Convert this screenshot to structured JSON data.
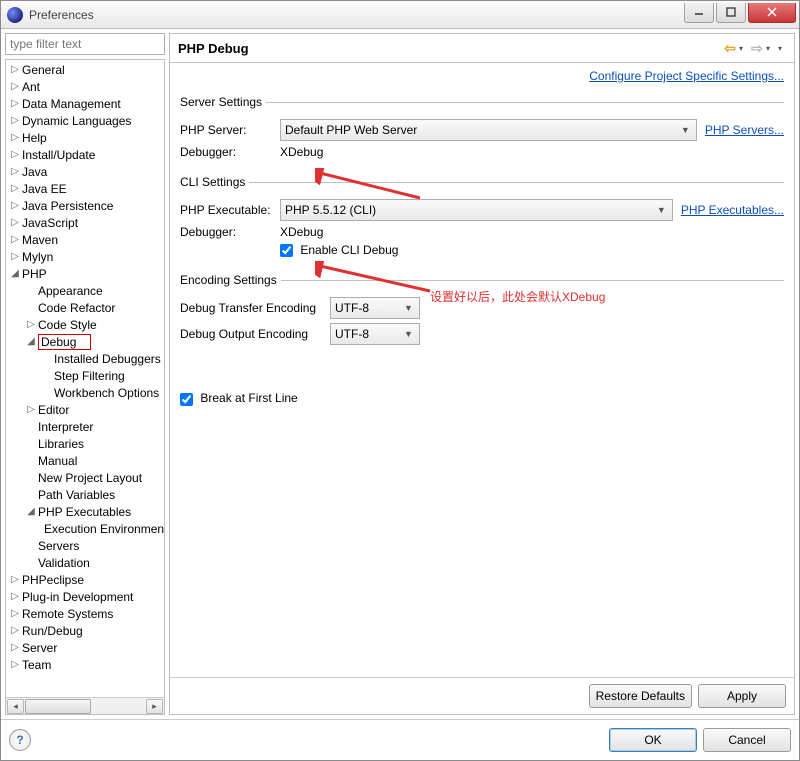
{
  "window": {
    "title": "Preferences"
  },
  "sidebar": {
    "filter_placeholder": "type filter text",
    "items": [
      {
        "label": "General",
        "depth": 0,
        "twisty": "▷"
      },
      {
        "label": "Ant",
        "depth": 0,
        "twisty": "▷"
      },
      {
        "label": "Data Management",
        "depth": 0,
        "twisty": "▷"
      },
      {
        "label": "Dynamic Languages",
        "depth": 0,
        "twisty": "▷"
      },
      {
        "label": "Help",
        "depth": 0,
        "twisty": "▷"
      },
      {
        "label": "Install/Update",
        "depth": 0,
        "twisty": "▷"
      },
      {
        "label": "Java",
        "depth": 0,
        "twisty": "▷"
      },
      {
        "label": "Java EE",
        "depth": 0,
        "twisty": "▷"
      },
      {
        "label": "Java Persistence",
        "depth": 0,
        "twisty": "▷"
      },
      {
        "label": "JavaScript",
        "depth": 0,
        "twisty": "▷"
      },
      {
        "label": "Maven",
        "depth": 0,
        "twisty": "▷"
      },
      {
        "label": "Mylyn",
        "depth": 0,
        "twisty": "▷"
      },
      {
        "label": "PHP",
        "depth": 0,
        "twisty": "◢"
      },
      {
        "label": "Appearance",
        "depth": 1,
        "twisty": ""
      },
      {
        "label": "Code Refactor",
        "depth": 1,
        "twisty": ""
      },
      {
        "label": "Code Style",
        "depth": 1,
        "twisty": "▷"
      },
      {
        "label": "Debug",
        "depth": 1,
        "twisty": "◢",
        "selected": true
      },
      {
        "label": "Installed Debuggers",
        "depth": 2,
        "twisty": ""
      },
      {
        "label": "Step Filtering",
        "depth": 2,
        "twisty": ""
      },
      {
        "label": "Workbench Options",
        "depth": 2,
        "twisty": ""
      },
      {
        "label": "Editor",
        "depth": 1,
        "twisty": "▷"
      },
      {
        "label": "Interpreter",
        "depth": 1,
        "twisty": ""
      },
      {
        "label": "Libraries",
        "depth": 1,
        "twisty": ""
      },
      {
        "label": "Manual",
        "depth": 1,
        "twisty": ""
      },
      {
        "label": "New Project Layout",
        "depth": 1,
        "twisty": ""
      },
      {
        "label": "Path Variables",
        "depth": 1,
        "twisty": ""
      },
      {
        "label": "PHP Executables",
        "depth": 1,
        "twisty": "◢"
      },
      {
        "label": "Execution Environments",
        "depth": 2,
        "twisty": ""
      },
      {
        "label": "Servers",
        "depth": 1,
        "twisty": ""
      },
      {
        "label": "Validation",
        "depth": 1,
        "twisty": ""
      },
      {
        "label": "PHPeclipse",
        "depth": 0,
        "twisty": "▷"
      },
      {
        "label": "Plug-in Development",
        "depth": 0,
        "twisty": "▷"
      },
      {
        "label": "Remote Systems",
        "depth": 0,
        "twisty": "▷"
      },
      {
        "label": "Run/Debug",
        "depth": 0,
        "twisty": "▷"
      },
      {
        "label": "Server",
        "depth": 0,
        "twisty": "▷"
      },
      {
        "label": "Team",
        "depth": 0,
        "twisty": "▷"
      }
    ]
  },
  "page": {
    "title": "PHP Debug",
    "configure_link": "Configure Project Specific Settings...",
    "server_group": {
      "legend": "Server Settings",
      "php_server_label": "PHP Server:",
      "php_server_value": "Default PHP Web Server",
      "php_servers_link": "PHP Servers...",
      "debugger_label": "Debugger:",
      "debugger_value": "XDebug"
    },
    "cli_group": {
      "legend": "CLI Settings",
      "exe_label": "PHP Executable:",
      "exe_value": "PHP 5.5.12 (CLI)",
      "exe_link": "PHP Executables...",
      "debugger_label": "Debugger:",
      "debugger_value": "XDebug",
      "enable_cli_label": "Enable CLI Debug",
      "enable_cli_checked": true
    },
    "encoding_group": {
      "legend": "Encoding Settings",
      "transfer_label": "Debug Transfer Encoding",
      "transfer_value": "UTF-8",
      "output_label": "Debug Output Encoding",
      "output_value": "UTF-8"
    },
    "break_first_label": "Break at First Line",
    "break_first_checked": true,
    "annotation_text": "设置好以后，此处会默认XDebug"
  },
  "buttons": {
    "restore": "Restore Defaults",
    "apply": "Apply",
    "ok": "OK",
    "cancel": "Cancel"
  }
}
